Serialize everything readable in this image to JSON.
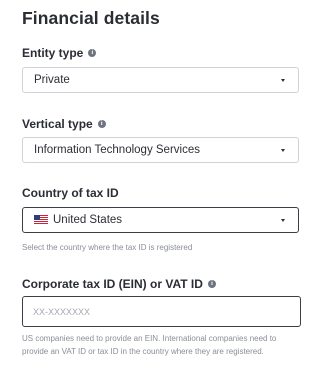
{
  "title": "Financial details",
  "entity_type": {
    "label": "Entity type",
    "info_icon": "info-icon",
    "selected": "Private"
  },
  "vertical_type": {
    "label": "Vertical type",
    "info_icon": "info-icon",
    "selected": "Information Technology Services"
  },
  "tax_country": {
    "label": "Country of tax ID",
    "flag_icon": "us-flag-icon",
    "selected": "United States",
    "help": "Select the country where the tax ID is registered"
  },
  "tax_id": {
    "label": "Corporate tax ID (EIN) or VAT ID",
    "info_icon": "info-icon",
    "value": "",
    "placeholder": "XX-XXXXXXX",
    "help": "US companies need to provide an EIN. International companies need to provide an VAT ID or tax ID in the country where they are registered."
  },
  "colors": {
    "text": "#2b2d35",
    "muted": "#8a8e98",
    "border": "#cfd2d8",
    "border_active": "#3b3e47"
  }
}
